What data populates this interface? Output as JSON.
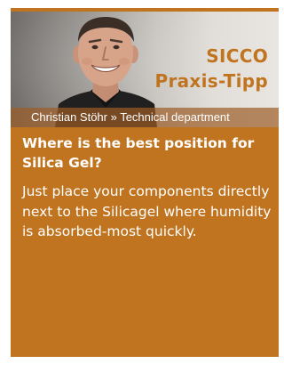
{
  "card": {
    "brand": {
      "line1": "SICCO",
      "line2": "Praxis-Tipp"
    },
    "caption": "Christian Stöhr » Technical department",
    "question": "Where is the best position for Silica Gel?",
    "answer": "Just place your components directly next to the Silicagel where humidity is absorbed-most quickly.",
    "colors": {
      "accent": "#c0741f",
      "text": "#ffffff"
    }
  }
}
